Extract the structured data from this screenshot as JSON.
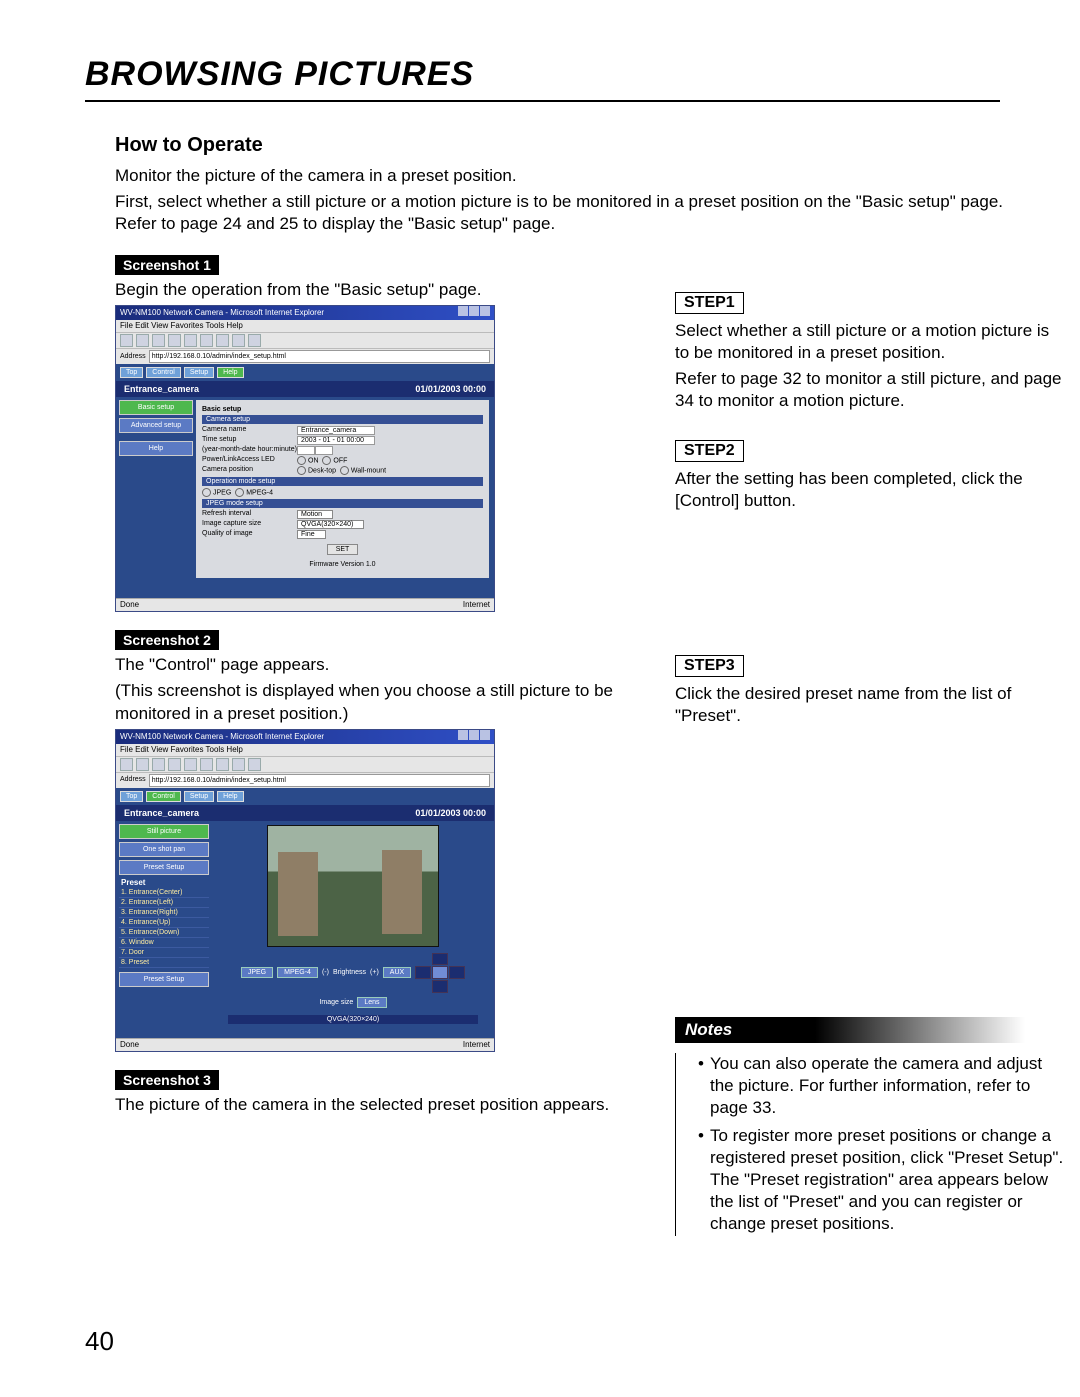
{
  "page_number": "40",
  "chapter_title": "BROWSING PICTURES",
  "section_title": "How to Operate",
  "intro_line1": "Monitor the picture of the camera in a preset position.",
  "intro_line2": "First, select whether a still picture or a motion picture is to be monitored in a preset position on the \"Basic setup\" page. Refer to page 24 and 25 to display the \"Basic setup\" page.",
  "labels": {
    "shot1": "Screenshot 1",
    "shot2": "Screenshot 2",
    "shot3": "Screenshot 3",
    "step1": "STEP1",
    "step2": "STEP2",
    "step3": "STEP3",
    "notes": "Notes"
  },
  "shot1_caption": "Begin the operation from the \"Basic setup\" page.",
  "shot2_caption_a": "The \"Control\" page appears.",
  "shot2_caption_b": "(This screenshot is displayed when you choose a still picture to be monitored in a preset position.)",
  "shot3_caption": "The picture of the camera in the selected preset position appears.",
  "step1_text_a": "Select whether a still picture or a motion picture is to be monitored in a preset position.",
  "step1_text_b": "Refer to page 32 to monitor a still picture, and page 34 to monitor a motion picture.",
  "step2_text": "After the setting has been completed, click the [Control] button.",
  "step3_text": "Click the desired preset name from the list of \"Preset\".",
  "notes_items": [
    "You can also operate the camera and adjust the picture. For further information, refer to page 33.",
    "To register more preset positions or change a registered preset position, click \"Preset Setup\". The \"Preset registration\" area appears below the list of \"Preset\" and you can register or change preset positions."
  ],
  "browser": {
    "title": "WV-NM100 Network Camera - Microsoft Internet Explorer",
    "menu": "File  Edit  View  Favorites  Tools  Help",
    "addr_label": "Address",
    "url": "http://192.168.0.10/admin/index_setup.html",
    "status_left": "Done",
    "status_right": "Internet",
    "camera_name": "Entrance_camera",
    "datetime": "01/01/2003  00:00",
    "top_buttons": [
      "Top",
      "Control",
      "Setup",
      "Help"
    ],
    "side_basic": "Basic setup",
    "side_adv": "Advanced setup",
    "side_help": "Help"
  },
  "setup_panel": {
    "title": "Basic setup",
    "h1": "Camera setup",
    "camera_name_label": "Camera name",
    "camera_name_value": "Entrance_camera",
    "time_label": "Time setup",
    "time_value": "2003 - 01 - 01  00:00",
    "ntp_label": "(year-month-date hour:minute)",
    "led_label": "Power/LinkAccess LED",
    "led_on": "ON",
    "led_off": "OFF",
    "pos_label": "Camera position",
    "pos_desk": "Desk-top",
    "pos_wall": "Wall-mount",
    "h2": "Operation mode setup",
    "mode_jpeg": "JPEG",
    "mode_mpeg": "MPEG-4",
    "h3": "JPEG mode setup",
    "refresh_label": "Refresh interval",
    "refresh_value": "Motion",
    "size_label": "Image capture size",
    "size_value": "QVGA(320×240)",
    "quality_label": "Quality of image",
    "quality_value": "Fine",
    "set_button": "SET",
    "version": "Firmware Version 1.0"
  },
  "control_panel": {
    "side_one": "One shot pan",
    "side_preset": "Preset Setup",
    "preset_header": "Preset",
    "presets": [
      "1.  Entrance(Center)",
      "2.  Entrance(Left)",
      "3.  Entrance(Right)",
      "4.  Entrance(Up)",
      "5.  Entrance(Down)",
      "6.  Window",
      "7.  Door",
      "8.  Preset"
    ],
    "preset_setup": "Preset Setup",
    "btn_jpeg": "JPEG",
    "btn_mpeg": "MPEG-4",
    "bri_label": "Brightness",
    "bri_minus": "(-)",
    "bri_plus": "(+)",
    "size_label": "Image size",
    "aux": "AUX",
    "lens": "Lens",
    "bottom": "QVGA(320×240)"
  }
}
